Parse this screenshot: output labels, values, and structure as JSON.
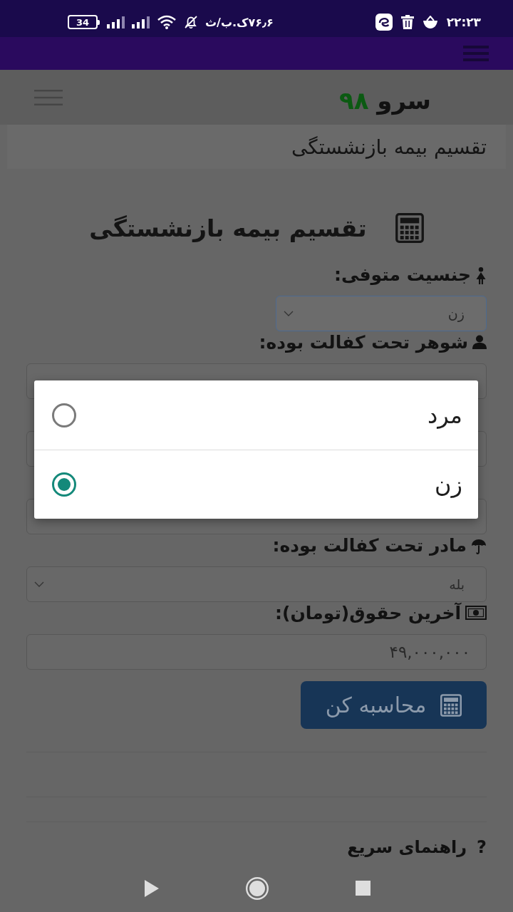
{
  "status_bar": {
    "battery": "34",
    "network_speed": "۷۶٫۶ک.ب/ث",
    "time": "۲۲:۲۳"
  },
  "header": {
    "logo_name": "سرو",
    "logo_number": "۹۸"
  },
  "breadcrumb": "تقسیم بیمه بازنشستگی",
  "form": {
    "title": "تقسیم بیمه بازنشستگی",
    "fields": [
      {
        "kind": "select",
        "label": "جنسیت متوفی:",
        "value": "زن",
        "focused": true
      },
      {
        "kind": "select",
        "label": "شوهر تحت کفالت بوده:",
        "focused": false
      },
      {
        "kind": "select",
        "focused": false
      },
      {
        "kind": "select",
        "focused": false
      },
      {
        "kind": "select",
        "label": "مادر تحت کفالت بوده:",
        "value": "بله",
        "focused": false
      },
      {
        "kind": "input",
        "label": "آخرین حقوق(تومان):",
        "value": "۴۹,۰۰۰,۰۰۰",
        "focused": false
      }
    ],
    "submit": "محاسبه کن"
  },
  "quick_help": {
    "mark": "?",
    "title": "راهنمای سریع"
  },
  "dialog": {
    "options": [
      {
        "label": "مرد",
        "selected": false
      },
      {
        "label": "زن",
        "selected": true
      }
    ]
  }
}
